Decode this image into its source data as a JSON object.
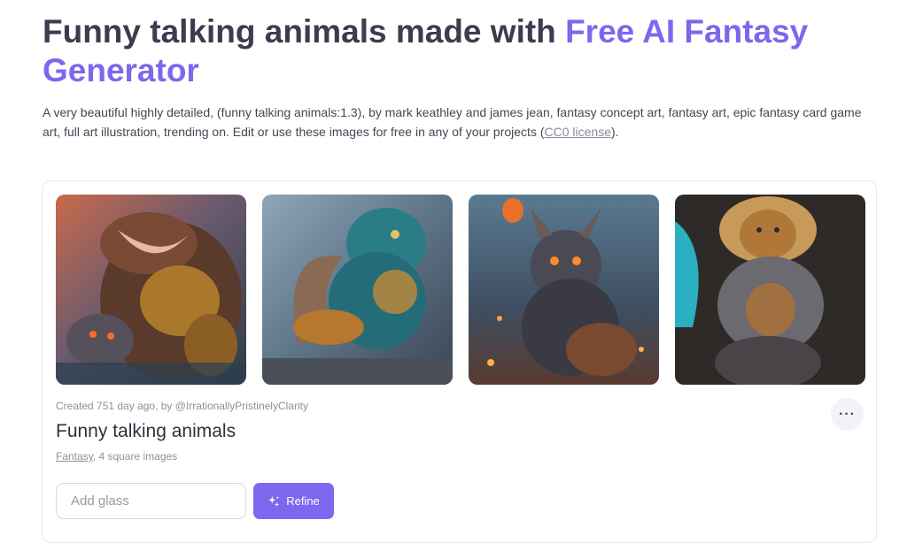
{
  "header": {
    "title_main": "Funny talking animals made with ",
    "title_accent": "Free AI Fantasy Generator",
    "description_text": "A very beautiful highly detailed, (funny talking animals:1.3), by mark keathley and james jean, fantasy concept art, fantasy art, epic fantasy card game art, full art illustration, trending on. Edit or use these images for free in any of your projects (",
    "license_link": "CC0 license",
    "description_end": ")."
  },
  "gallery": {
    "images": [
      {
        "name": "generated-image-1"
      },
      {
        "name": "generated-image-2"
      },
      {
        "name": "generated-image-3"
      },
      {
        "name": "generated-image-4"
      }
    ],
    "created_text": "Created 751 day ago, by @IrrationallyPristinelyClarity",
    "title": "Funny talking animals",
    "category_link": "Fantasy",
    "details_text": ", 4 square images",
    "more_icon": "ellipsis-icon",
    "more_label": "···"
  },
  "refine": {
    "placeholder": "Add glass",
    "button_label": "Refine",
    "button_icon": "sparkle-icon"
  },
  "colors": {
    "accent": "#7b68ee"
  }
}
